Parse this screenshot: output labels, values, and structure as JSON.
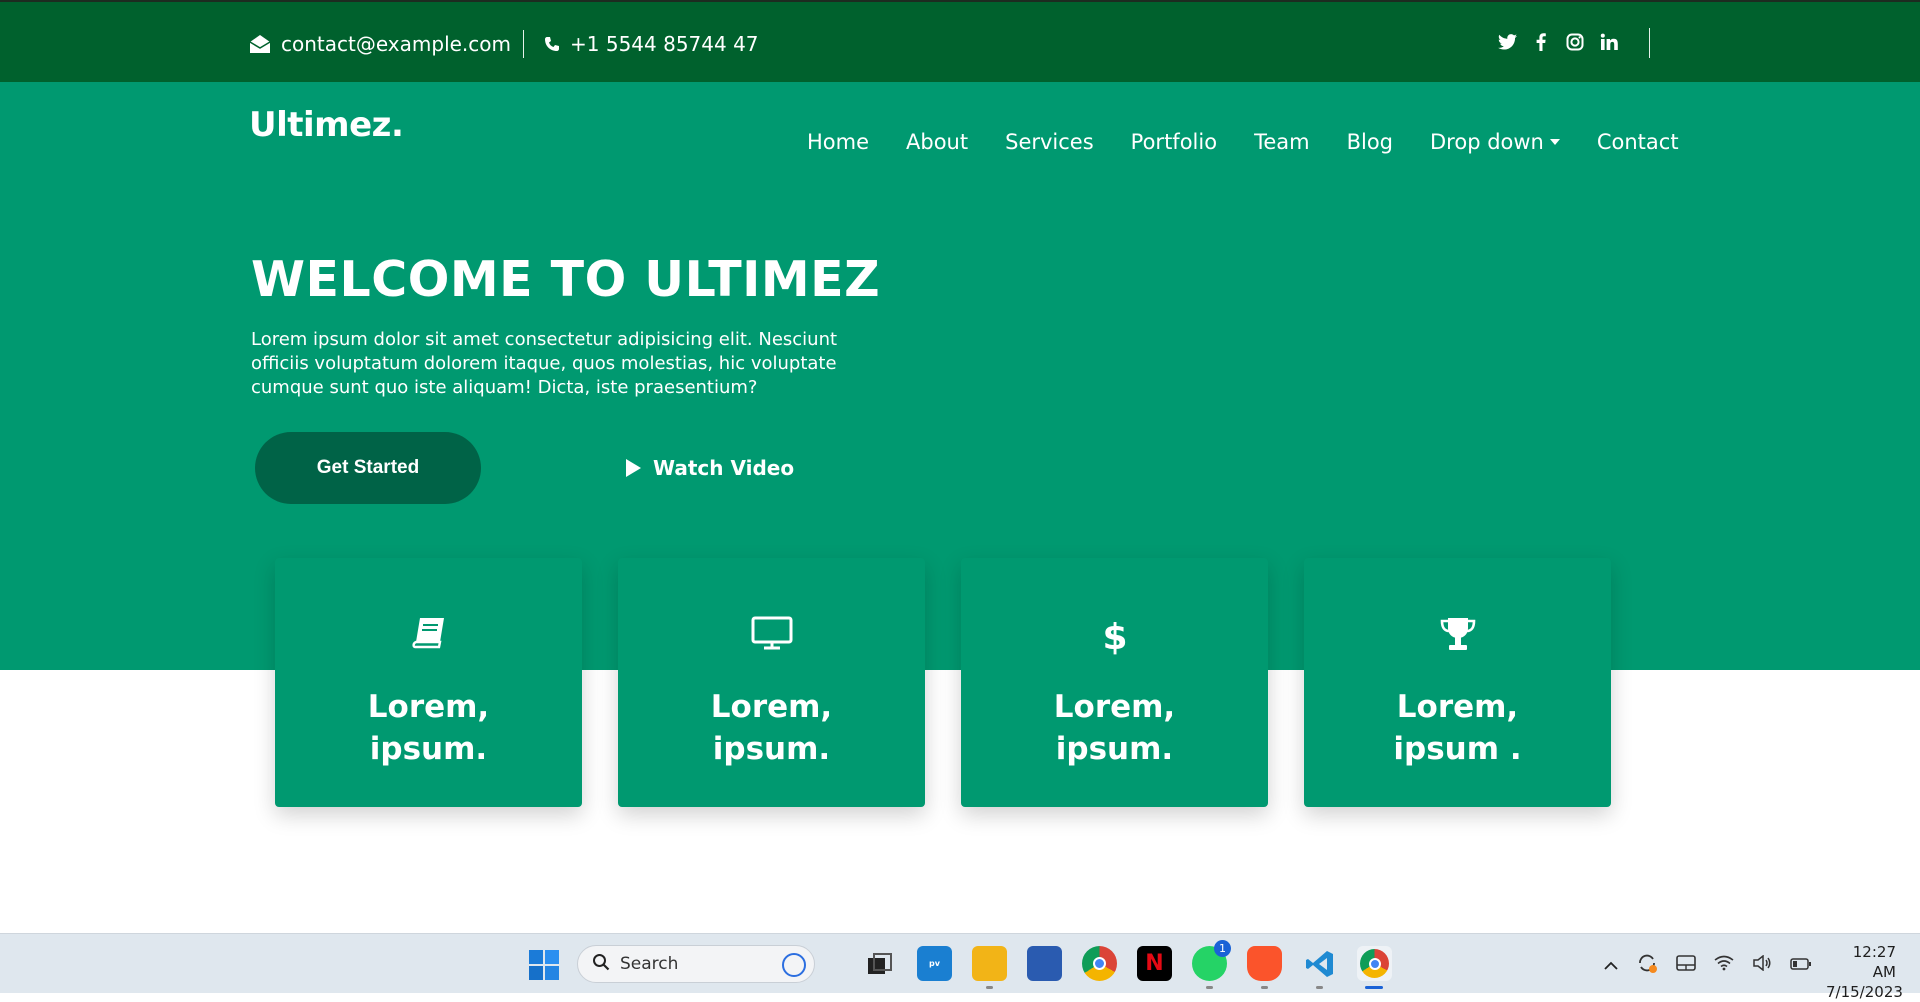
{
  "topbar": {
    "email": "contact@example.com",
    "phone": "+1 5544 85744 47",
    "socials": [
      "twitter-icon",
      "facebook-icon",
      "instagram-icon",
      "linkedin-icon"
    ],
    "bg_color": "#00612d"
  },
  "header": {
    "logo": "Ultimez.",
    "nav": [
      {
        "label": "Home"
      },
      {
        "label": "About"
      },
      {
        "label": "Services"
      },
      {
        "label": "Portfolio"
      },
      {
        "label": "Team"
      },
      {
        "label": "Blog"
      },
      {
        "label": "Drop down",
        "dropdown": true
      },
      {
        "label": "Contact"
      }
    ]
  },
  "hero": {
    "title": "WELCOME TO ULTIMEZ",
    "text": "Lorem ipsum dolor sit amet consectetur adipisicing elit. Nesciunt officiis voluptatum dolorem itaque, quos molestias, hic voluptate cumque sunt quo iste aliquam! Dicta, iste praesentium?",
    "cta_primary": "Get Started",
    "cta_secondary": "Watch Video",
    "bg_color": "#009970",
    "button_color": "#006347"
  },
  "cards": [
    {
      "icon": "book-icon",
      "line1": "Lorem,",
      "line2": "ipsum."
    },
    {
      "icon": "monitor-icon",
      "line1": "Lorem,",
      "line2": "ipsum."
    },
    {
      "icon": "dollar-icon",
      "line1": "Lorem,",
      "line2": "ipsum."
    },
    {
      "icon": "trophy-icon",
      "line1": "Lorem,",
      "line2": "ipsum ."
    }
  ],
  "taskbar": {
    "search_placeholder": "Search",
    "time": "12:27 AM",
    "date": "7/15/2023",
    "whatsapp_badge": "1",
    "apps": [
      "task-view-icon",
      "prime-video-icon",
      "file-explorer-icon",
      "store-icon",
      "chrome-icon",
      "netflix-icon",
      "whatsapp-icon",
      "brave-icon",
      "vscode-icon",
      "chrome-active-icon"
    ]
  }
}
